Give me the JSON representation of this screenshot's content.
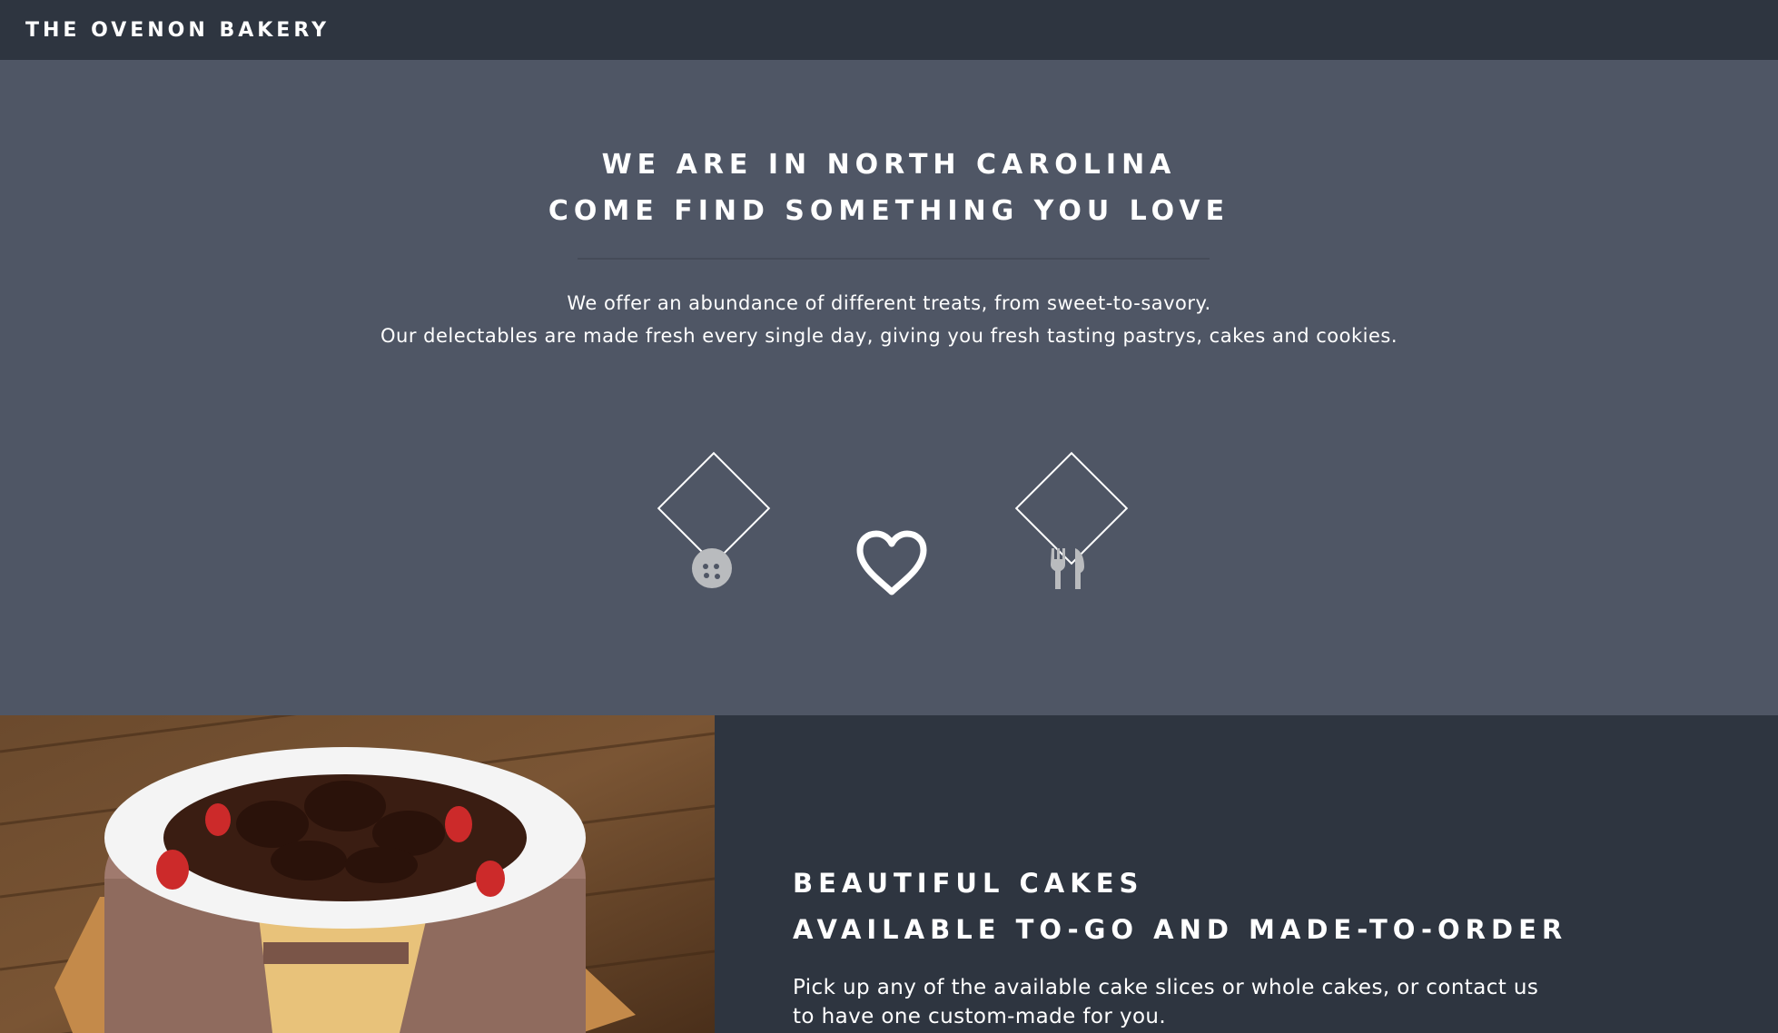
{
  "nav": {
    "brand": "THE OVENON BAKERY"
  },
  "intro": {
    "heading_line1": "WE ARE IN NORTH CAROLINA",
    "heading_line2": "COME FIND SOMETHING YOU LOVE",
    "text_line1": "We offer an abundance of different treats, from sweet-to-savory.",
    "text_line2": "Our delectables are made fresh every single day, giving you fresh tasting pastrys, cakes and cookies.",
    "icons": [
      "cookie-icon",
      "heart-icon",
      "utensils-icon"
    ]
  },
  "cakes": {
    "heading_line1": "BEAUTIFUL CAKES",
    "heading_line2": "AVAILABLE TO-GO AND MADE-TO-ORDER",
    "description": "Pick up any of the available cake slices or whole cakes, or contact us to have one custom-made for you."
  },
  "colors": {
    "navbar": "#2e3540",
    "intro_bg": "#4f5665",
    "icon_fill": "#b9bbbe",
    "text": "#ffffff"
  }
}
